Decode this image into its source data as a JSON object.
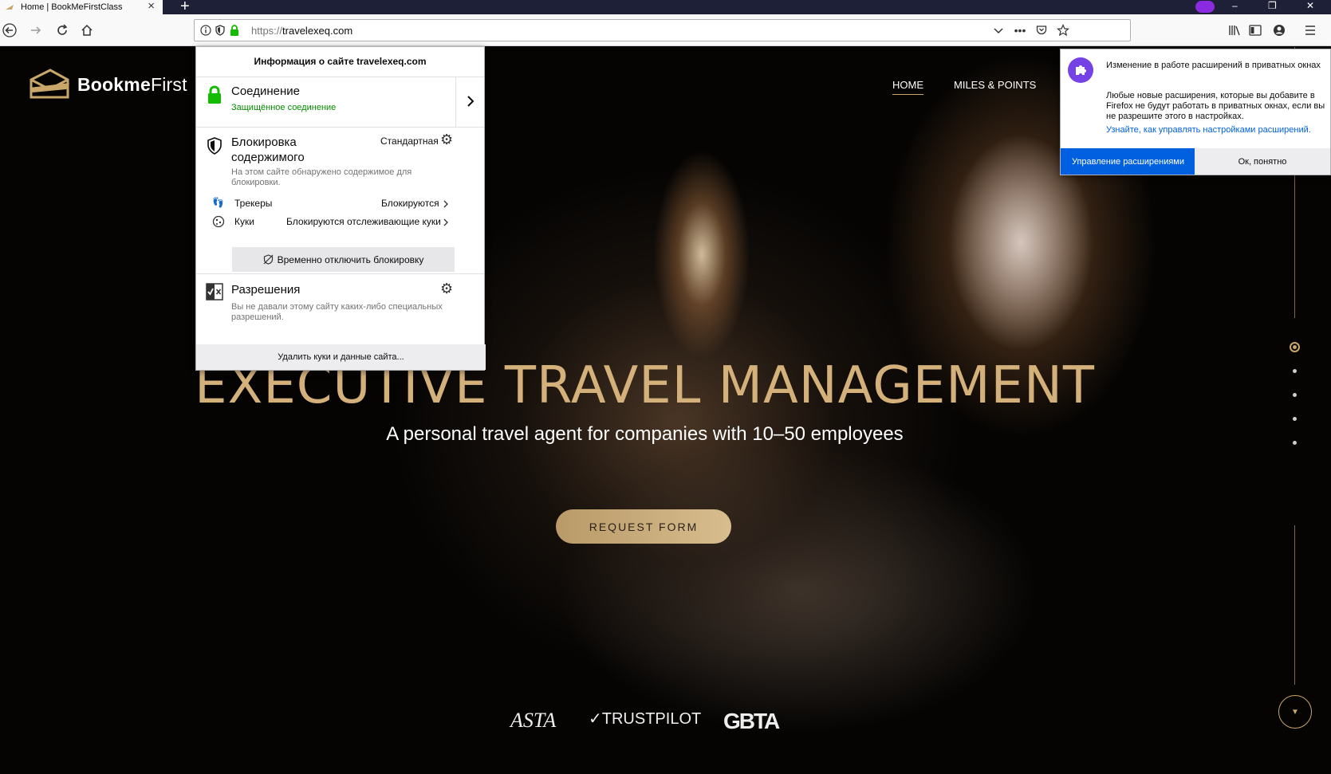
{
  "browser": {
    "tab_title": "Home | BookMeFirstClass",
    "url_scheme": "https://",
    "url_host": "travelexeq.com"
  },
  "site": {
    "logo_bold": "Bookme",
    "logo_thin": "First",
    "nav": [
      {
        "label": "HOME"
      },
      {
        "label": "MILES & POINTS"
      }
    ],
    "headline": "EXECUTIVE TRAVEL MANAGEMENT",
    "subline": "A personal travel agent for companies with 10–50 employees",
    "cta": "REQUEST FORM",
    "partners": [
      "ASTA",
      "TRUSTPILOT",
      "GBTA"
    ]
  },
  "site_info_panel": {
    "header": "Информация о сайте travelexeq.com",
    "connection_title": "Соединение",
    "connection_status": "Защищённое соединение",
    "blocking_title_1": "Блокировка",
    "blocking_title_2": "содержимого",
    "blocking_mode": "Стандартная",
    "blocking_desc": "На этом сайте обнаружено содержимое для блокировки.",
    "trackers_label": "Трекеры",
    "trackers_value": "Блокируются",
    "cookies_label": "Куки",
    "cookies_value": "Блокируются отслеживающие куки",
    "disable_button": "Временно отключить блокировку",
    "permissions_title": "Разрешения",
    "permissions_desc": "Вы не давали этому сайту каких-либо специальных разрешений.",
    "clear_button": "Удалить куки и данные сайта..."
  },
  "extension_doorhanger": {
    "title": "Изменение в работе расширений в приватных окнах",
    "body": "Любые новые расширения, которые вы добавите в Firefox не будут работать в приватных окнах, если вы не разрешите этого в настройках.",
    "link": "Узнайте, как управлять настройками расширений.",
    "primary_button": "Управление расширениями",
    "secondary_button": "Ок, понятно"
  },
  "colors": {
    "accent_gold": "#d4b07a",
    "firefox_blue": "#0060df",
    "secure_green": "#12bc00"
  }
}
